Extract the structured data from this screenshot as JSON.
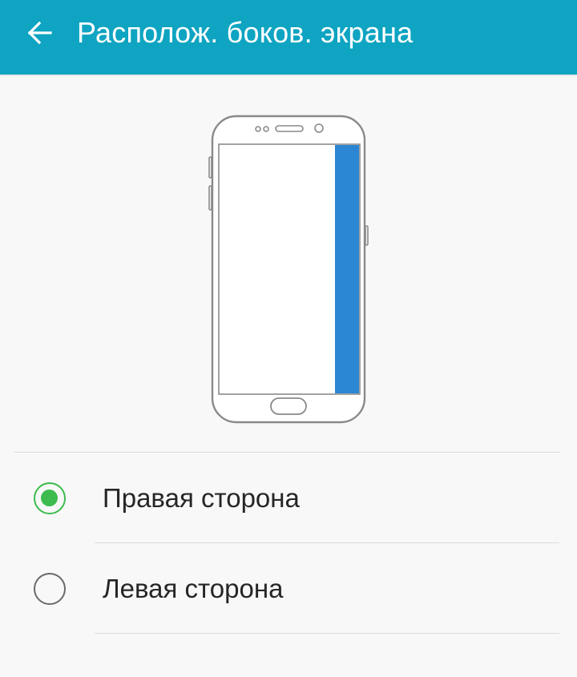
{
  "app_bar": {
    "title": "Располож. боков. экрана",
    "background_color": "#0ea4c2",
    "back_icon": "arrow-left-icon"
  },
  "illustration": {
    "icon": "phone-edge-panel-icon",
    "highlighted_edge": "right",
    "edge_color": "#2b86d3"
  },
  "options": [
    {
      "label": "Правая сторона",
      "selected": true
    },
    {
      "label": "Левая сторона",
      "selected": false
    }
  ],
  "accent_color": "#3dbb4e"
}
